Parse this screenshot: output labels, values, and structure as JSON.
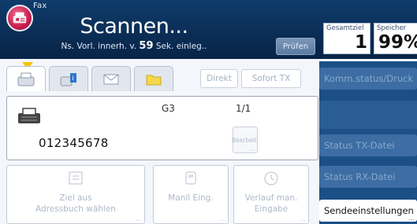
{
  "app": {
    "name": "Fax"
  },
  "header": {
    "title": "Scannen...",
    "subtitle_prefix": "Ns. Vorl. innerh. v.",
    "subtitle_seconds": "59",
    "subtitle_suffix": "Sek. einleg..",
    "check_label": "Prüfen"
  },
  "counters": {
    "total_caption": "Gesamtziel",
    "total_value": "1",
    "memory_caption": "Speicher",
    "memory_value": "99%"
  },
  "toolbar": {
    "direct_label": "Direkt",
    "immediate_tx_label": "Sofort TX"
  },
  "main": {
    "mode": "G3",
    "pages": "1/1",
    "destination": "012345678",
    "edit_label": "Bearbeit."
  },
  "bottom_buttons": [
    {
      "label_line1": "Ziel aus",
      "label_line2": "Adressbuch wählen"
    },
    {
      "label_line1": "Manll Eing.",
      "label_line2": ""
    },
    {
      "label_line1": "Verlauf man.",
      "label_line2": "Eingabe"
    }
  ],
  "right_panel": {
    "status_label": "Komm.status/Druck",
    "tx_file_status": "Status TX-Datei",
    "rx_file_status": "Status RX-Datei",
    "send_settings": "Sendeeinstellungen"
  },
  "colors": {
    "header_bg": "#0b2d55",
    "accent_logo": "#c81e50",
    "tab_marker": "#f4c400",
    "right_panel_bg": "#1b4f86"
  }
}
